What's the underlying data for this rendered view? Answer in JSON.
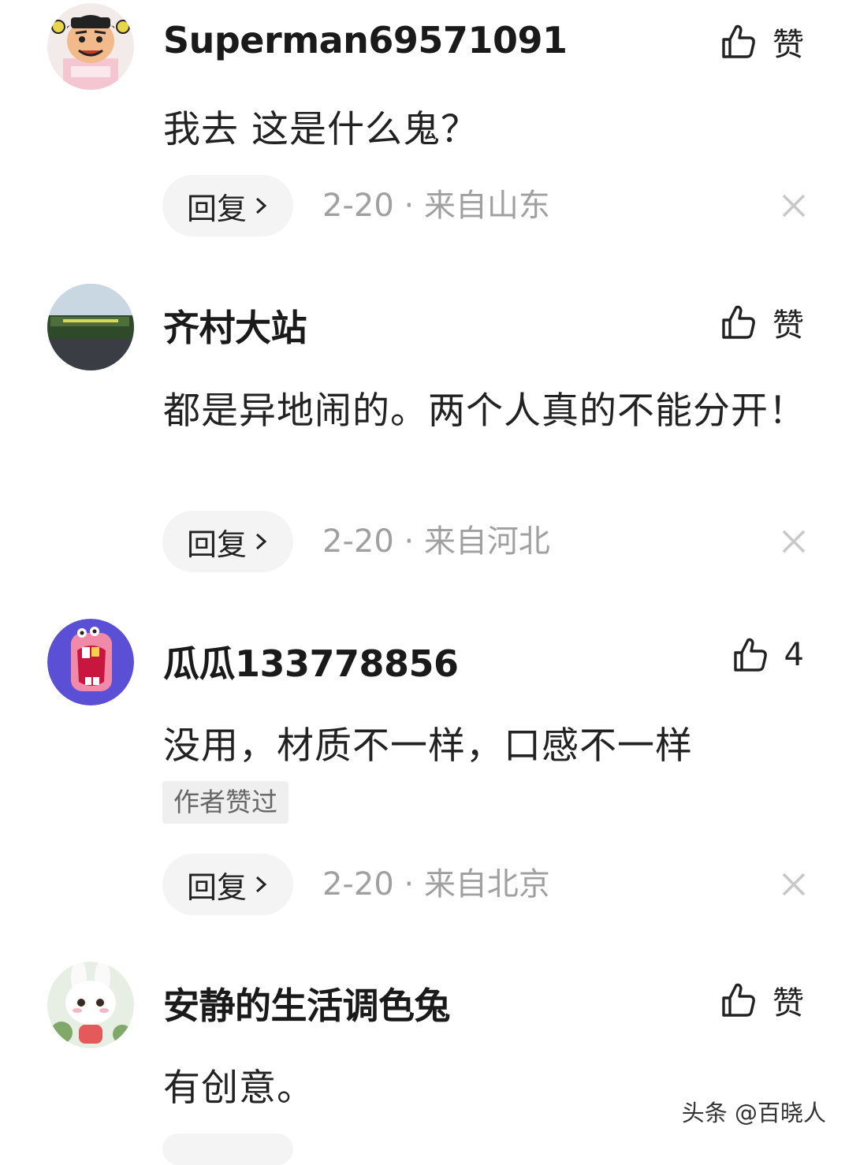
{
  "comments": [
    {
      "username": "Superman69571091",
      "avatar_icon": "cartoon-man-avatar-icon",
      "like_label": "赞",
      "text": "我去 这是什么鬼？",
      "reply_label": "回复",
      "date": "2-20",
      "separator": " · ",
      "location": "来自山东"
    },
    {
      "username": "齐村大站",
      "avatar_icon": "landscape-photo-avatar-icon",
      "like_label": "赞",
      "text": "都是异地闹的。两个人真的不能分开！",
      "reply_label": "回复",
      "date": "2-20",
      "separator": " · ",
      "location": "来自河北"
    },
    {
      "username": "瓜瓜133778856",
      "avatar_icon": "cartoon-mouth-avatar-icon",
      "like_label": "4",
      "text": "没用，材质不一样，口感不一样",
      "badge": "作者赞过",
      "reply_label": "回复",
      "date": "2-20",
      "separator": " · ",
      "location": "来自北京"
    },
    {
      "username": "安静的生活调色兔",
      "avatar_icon": "bunny-avatar-icon",
      "like_label": "赞",
      "text": "有创意。"
    }
  ],
  "watermark": "头条 @百晓人",
  "colors": {
    "text": "#222222",
    "meta": "#a0a0a0",
    "reply_bg": "#f4f4f4",
    "badge_bg": "#efefef",
    "avatar_3_bg": "#5b4fd6"
  }
}
